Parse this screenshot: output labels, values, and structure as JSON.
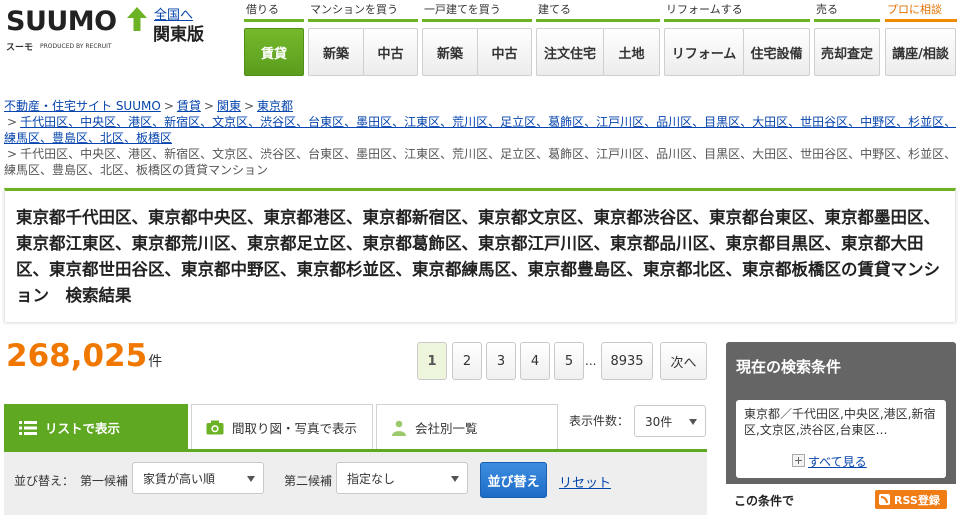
{
  "header": {
    "logo_text": "SUUMO",
    "logo_sub": "スーモ",
    "logo_produced": "PRODUCED BY RECRUIT",
    "region_link": "全国へ",
    "region_name": "関東版",
    "categories": [
      {
        "label": "借りる"
      },
      {
        "label": "マンションを買う"
      },
      {
        "label": "一戸建てを買う"
      },
      {
        "label": "建てる"
      },
      {
        "label": "リフォームする"
      },
      {
        "label": "売る"
      },
      {
        "label": "プロに相談"
      }
    ],
    "buttons": [
      {
        "label": "賃貸"
      },
      {
        "label": "新築"
      },
      {
        "label": "中古"
      },
      {
        "label": "新築"
      },
      {
        "label": "中古"
      },
      {
        "label": "注文住宅"
      },
      {
        "label": "土地"
      },
      {
        "label": "リフォーム"
      },
      {
        "label": "住宅設備"
      },
      {
        "label": "売却査定"
      },
      {
        "label": "講座/相談"
      }
    ]
  },
  "breadcrumb": {
    "items": [
      "不動産・住宅サイト SUUMO",
      "賃貸",
      "関東",
      "東京都"
    ],
    "linked_wards_1": "千代田区、中央区、港区、新宿区、文京区、渋谷区、台東区、墨田区、江東区、荒川区、足立区、葛飾区、江戸川区、品川区、目黒区、大田区、世田谷区、中野区、杉並区、",
    "linked_wards_2": "練馬区、豊島区、北区、板橋区",
    "plain_wards_1": "千代田区、中央区、港区、新宿区、文京区、渋谷区、台東区、墨田区、江東区、荒川区、足立区、葛飾区、江戸川区、品川区、目黒区、大田区、世田谷区、中野区、杉並区、",
    "plain_wards_2": "練馬区、豊島区、北区、板橋区の賃貸マンション"
  },
  "page_title": "東京都千代田区、東京都中央区、東京都港区、東京都新宿区、東京都文京区、東京都渋谷区、東京都台東区、東京都墨田区、東京都江東区、東京都荒川区、東京都足立区、東京都葛飾区、東京都江戸川区、東京都品川区、東京都目黒区、東京都大田区、東京都世田谷区、東京都中野区、東京都杉並区、東京都練馬区、東京都豊島区、東京都北区、東京都板橋区の賃貸マンション　検索結果",
  "result": {
    "count": "268,025",
    "unit": "件"
  },
  "pager": {
    "pages": [
      "1",
      "2",
      "3",
      "4",
      "5"
    ],
    "current": "1",
    "ellipsis": "...",
    "last": "8935",
    "next": "次へ"
  },
  "view_tabs": [
    {
      "label": "リストで表示",
      "icon": "list-icon"
    },
    {
      "label": "間取り図・写真で表示",
      "icon": "camera-icon"
    },
    {
      "label": "会社別一覧",
      "icon": "person-icon"
    }
  ],
  "display_count": {
    "label": "表示件数：",
    "value": "30件"
  },
  "sort": {
    "label": "並び替え：",
    "first_label": "第一候補",
    "first_value": "家賃が高い順",
    "second_label": "第二候補",
    "second_value": "指定なし",
    "apply_label": "並び替え",
    "reset_label": "リセット"
  },
  "side_panel": {
    "title": "現在の検索条件",
    "conditions": "東京都／千代田区,中央区,港区,新宿区,文京区,渋谷区,台東区…",
    "see_all": "すべて見る",
    "footer_label": "この条件で",
    "rss_label": "RSS登録"
  },
  "colors": {
    "brand_green": "#6bb324",
    "count_orange": "#f07800",
    "link_blue": "#0645ad",
    "button_blue": "#1e6cc6",
    "rss_orange": "#f07c16"
  }
}
